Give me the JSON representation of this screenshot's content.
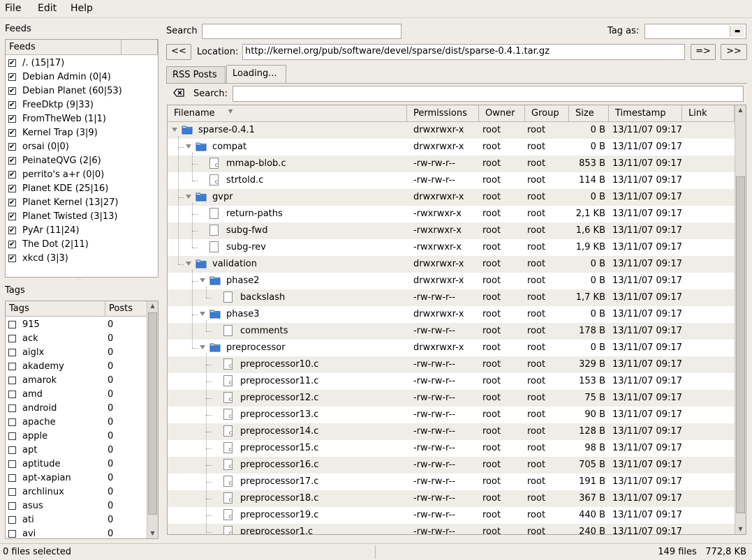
{
  "menu": [
    "File",
    "Edit",
    "Help"
  ],
  "feeds": {
    "section_label": "Feeds",
    "header": "Feeds",
    "items": [
      {
        "label": "/. (15|17)",
        "checked": true
      },
      {
        "label": "Debian Admin (0|4)",
        "checked": true
      },
      {
        "label": "Debian Planet (60|53)",
        "checked": true
      },
      {
        "label": "FreeDktp (9|33)",
        "checked": true
      },
      {
        "label": "FromTheWeb (1|1)",
        "checked": true
      },
      {
        "label": "Kernel Trap (3|9)",
        "checked": true
      },
      {
        "label": "orsai (0|0)",
        "checked": true
      },
      {
        "label": "PeinateQVG (2|6)",
        "checked": true
      },
      {
        "label": "perrito's a+r (0|0)",
        "checked": true
      },
      {
        "label": "Planet KDE (25|16)",
        "checked": true
      },
      {
        "label": "Planet Kernel (13|27)",
        "checked": true
      },
      {
        "label": "Planet Twisted (3|13)",
        "checked": true
      },
      {
        "label": "PyAr (11|24)",
        "checked": true
      },
      {
        "label": "The Dot (2|11)",
        "checked": true
      },
      {
        "label": "xkcd (3|3)",
        "checked": true
      }
    ]
  },
  "tags": {
    "section_label": "Tags",
    "header_tags": "Tags",
    "header_posts": "Posts",
    "items": [
      {
        "label": "915",
        "posts": "0"
      },
      {
        "label": "ack",
        "posts": "0"
      },
      {
        "label": "aiglx",
        "posts": "0"
      },
      {
        "label": "akademy",
        "posts": "0"
      },
      {
        "label": "amarok",
        "posts": "0"
      },
      {
        "label": "amd",
        "posts": "0"
      },
      {
        "label": "android",
        "posts": "0"
      },
      {
        "label": "apache",
        "posts": "0"
      },
      {
        "label": "apple",
        "posts": "0"
      },
      {
        "label": "apt",
        "posts": "0"
      },
      {
        "label": "aptitude",
        "posts": "0"
      },
      {
        "label": "apt-xapian",
        "posts": "0"
      },
      {
        "label": "archlinux",
        "posts": "0"
      },
      {
        "label": "asus",
        "posts": "0"
      },
      {
        "label": "ati",
        "posts": "0"
      },
      {
        "label": "avi",
        "posts": "0"
      }
    ]
  },
  "top": {
    "search_label": "Search",
    "search_value": "",
    "tag_as_label": "Tag as:",
    "tag_as_value": ""
  },
  "location": {
    "back_label": "<<",
    "label": "Location:",
    "url": "http://kernel.org/pub/software/devel/sparse/dist/sparse-0.4.1.tar.gz",
    "go_label": "=>",
    "forward_label": ">>"
  },
  "tabs": [
    {
      "label": "RSS Posts",
      "active": false
    },
    {
      "label": "Loading...",
      "active": true
    }
  ],
  "inner_search": {
    "label": "Search:",
    "value": ""
  },
  "file_table": {
    "columns": [
      "Filename",
      "Permissions",
      "Owner",
      "Group",
      "Size",
      "Timestamp",
      "Link"
    ],
    "rows": [
      {
        "name": "sparse-0.4.1",
        "type": "folder",
        "depth": 0,
        "perm": "drwxrwxr-x",
        "owner": "root",
        "group": "root",
        "size": "0 B",
        "ts": "13/11/07 09:17"
      },
      {
        "name": "compat",
        "type": "folder",
        "depth": 1,
        "perm": "drwxrwxr-x",
        "owner": "root",
        "group": "root",
        "size": "0 B",
        "ts": "13/11/07 09:17"
      },
      {
        "name": "mmap-blob.c",
        "type": "cfile",
        "depth": 2,
        "perm": "-rw-rw-r--",
        "owner": "root",
        "group": "root",
        "size": "853 B",
        "ts": "13/11/07 09:17"
      },
      {
        "name": "strtold.c",
        "type": "cfile",
        "depth": 2,
        "perm": "-rw-rw-r--",
        "owner": "root",
        "group": "root",
        "size": "114 B",
        "ts": "13/11/07 09:17"
      },
      {
        "name": "gvpr",
        "type": "folder",
        "depth": 1,
        "perm": "drwxrwxr-x",
        "owner": "root",
        "group": "root",
        "size": "0 B",
        "ts": "13/11/07 09:17"
      },
      {
        "name": "return-paths",
        "type": "file",
        "depth": 2,
        "perm": "-rwxrwxr-x",
        "owner": "root",
        "group": "root",
        "size": "2,1 KB",
        "ts": "13/11/07 09:17"
      },
      {
        "name": "subg-fwd",
        "type": "file",
        "depth": 2,
        "perm": "-rwxrwxr-x",
        "owner": "root",
        "group": "root",
        "size": "1,6 KB",
        "ts": "13/11/07 09:17"
      },
      {
        "name": "subg-rev",
        "type": "file",
        "depth": 2,
        "perm": "-rwxrwxr-x",
        "owner": "root",
        "group": "root",
        "size": "1,9 KB",
        "ts": "13/11/07 09:17"
      },
      {
        "name": "validation",
        "type": "folder",
        "depth": 1,
        "perm": "drwxrwxr-x",
        "owner": "root",
        "group": "root",
        "size": "0 B",
        "ts": "13/11/07 09:17"
      },
      {
        "name": "phase2",
        "type": "folder",
        "depth": 2,
        "perm": "drwxrwxr-x",
        "owner": "root",
        "group": "root",
        "size": "0 B",
        "ts": "13/11/07 09:17"
      },
      {
        "name": "backslash",
        "type": "file",
        "depth": 3,
        "perm": "-rw-rw-r--",
        "owner": "root",
        "group": "root",
        "size": "1,7 KB",
        "ts": "13/11/07 09:17"
      },
      {
        "name": "phase3",
        "type": "folder",
        "depth": 2,
        "perm": "drwxrwxr-x",
        "owner": "root",
        "group": "root",
        "size": "0 B",
        "ts": "13/11/07 09:17"
      },
      {
        "name": "comments",
        "type": "file",
        "depth": 3,
        "perm": "-rw-rw-r--",
        "owner": "root",
        "group": "root",
        "size": "178 B",
        "ts": "13/11/07 09:17"
      },
      {
        "name": "preprocessor",
        "type": "folder",
        "depth": 2,
        "perm": "drwxrwxr-x",
        "owner": "root",
        "group": "root",
        "size": "0 B",
        "ts": "13/11/07 09:17"
      },
      {
        "name": "preprocessor10.c",
        "type": "cfile",
        "depth": 3,
        "perm": "-rw-rw-r--",
        "owner": "root",
        "group": "root",
        "size": "329 B",
        "ts": "13/11/07 09:17"
      },
      {
        "name": "preprocessor11.c",
        "type": "cfile",
        "depth": 3,
        "perm": "-rw-rw-r--",
        "owner": "root",
        "group": "root",
        "size": "153 B",
        "ts": "13/11/07 09:17"
      },
      {
        "name": "preprocessor12.c",
        "type": "cfile",
        "depth": 3,
        "perm": "-rw-rw-r--",
        "owner": "root",
        "group": "root",
        "size": "75 B",
        "ts": "13/11/07 09:17"
      },
      {
        "name": "preprocessor13.c",
        "type": "cfile",
        "depth": 3,
        "perm": "-rw-rw-r--",
        "owner": "root",
        "group": "root",
        "size": "90 B",
        "ts": "13/11/07 09:17"
      },
      {
        "name": "preprocessor14.c",
        "type": "cfile",
        "depth": 3,
        "perm": "-rw-rw-r--",
        "owner": "root",
        "group": "root",
        "size": "128 B",
        "ts": "13/11/07 09:17"
      },
      {
        "name": "preprocessor15.c",
        "type": "cfile",
        "depth": 3,
        "perm": "-rw-rw-r--",
        "owner": "root",
        "group": "root",
        "size": "98 B",
        "ts": "13/11/07 09:17"
      },
      {
        "name": "preprocessor16.c",
        "type": "cfile",
        "depth": 3,
        "perm": "-rw-rw-r--",
        "owner": "root",
        "group": "root",
        "size": "705 B",
        "ts": "13/11/07 09:17"
      },
      {
        "name": "preprocessor17.c",
        "type": "cfile",
        "depth": 3,
        "perm": "-rw-rw-r--",
        "owner": "root",
        "group": "root",
        "size": "191 B",
        "ts": "13/11/07 09:17"
      },
      {
        "name": "preprocessor18.c",
        "type": "cfile",
        "depth": 3,
        "perm": "-rw-rw-r--",
        "owner": "root",
        "group": "root",
        "size": "367 B",
        "ts": "13/11/07 09:17"
      },
      {
        "name": "preprocessor19.c",
        "type": "cfile",
        "depth": 3,
        "perm": "-rw-rw-r--",
        "owner": "root",
        "group": "root",
        "size": "440 B",
        "ts": "13/11/07 09:17"
      },
      {
        "name": "preprocessor1.c",
        "type": "cfile",
        "depth": 3,
        "perm": "-rw-rw-r--",
        "owner": "root",
        "group": "root",
        "size": "240 B",
        "ts": "13/11/07 09:17"
      }
    ]
  },
  "status": {
    "selection": "0 files selected",
    "summary": "149 files   772,8 KB"
  },
  "colors": {
    "folder": "#3a7bd5",
    "alt_row": "#efede7",
    "window_bg": "#efebe7"
  }
}
